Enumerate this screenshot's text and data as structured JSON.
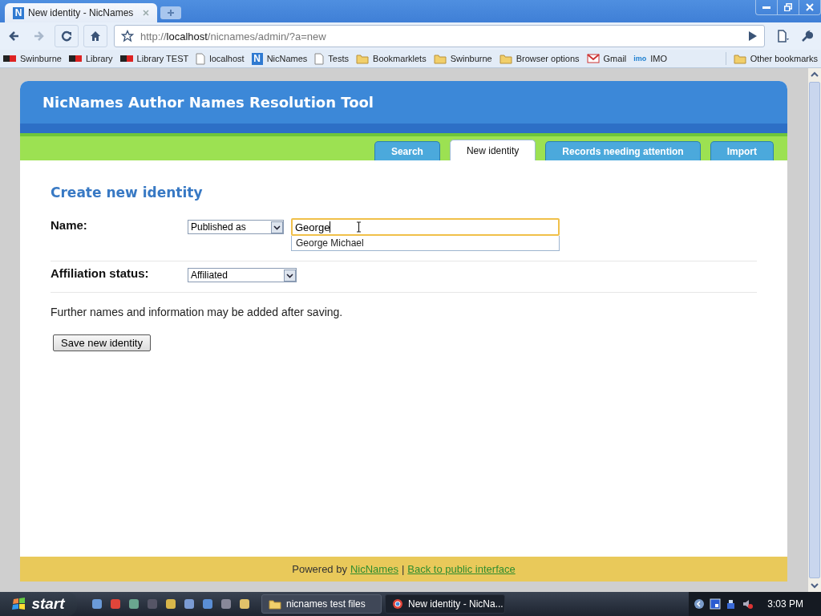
{
  "browser": {
    "tabs": [
      {
        "title": "New identity - NicNames",
        "icon_letter": "N"
      }
    ],
    "address": {
      "scheme": "http://",
      "host": "localhost",
      "path": "/nicnames/admin/?a=new"
    },
    "bookmarks": [
      {
        "kind": "site",
        "label": "Swinburne"
      },
      {
        "kind": "site",
        "label": "Library"
      },
      {
        "kind": "site",
        "label": "Library TEST"
      },
      {
        "kind": "page",
        "label": "localhost"
      },
      {
        "kind": "letter",
        "icon_letter": "N",
        "label": "NicNames"
      },
      {
        "kind": "page",
        "label": "Tests"
      },
      {
        "kind": "folder",
        "label": "Bookmarklets"
      },
      {
        "kind": "folder",
        "label": "Swinburne"
      },
      {
        "kind": "folder",
        "label": "Browser options"
      },
      {
        "kind": "mail",
        "label": "Gmail"
      },
      {
        "kind": "badge",
        "icon_letter": "imo",
        "label": "IMO"
      }
    ],
    "other_bookmarks": "Other bookmarks"
  },
  "page": {
    "title": "NicNames Author Names Resolution Tool",
    "nav": [
      {
        "label": "Search",
        "selected": false
      },
      {
        "label": "New identity",
        "selected": true
      },
      {
        "label": "Records needing attention",
        "selected": false
      },
      {
        "label": "Import",
        "selected": false
      }
    ],
    "heading": "Create new identity",
    "fields": [
      {
        "label": "Name:",
        "select": "Published as",
        "value": "George",
        "suggestions": [
          "George Michael"
        ]
      },
      {
        "label": "Affiliation status:",
        "select": "Affiliated"
      }
    ],
    "note": "Further names and information may be added after saving.",
    "save_button": "Save new identity",
    "footer": {
      "prefix": "Powered by",
      "link": "NicNames",
      "separator": "|",
      "link2": "Back to public interface"
    }
  },
  "taskbar": {
    "start": "start",
    "windows": [
      {
        "title": "nicnames test files",
        "kind": "folder",
        "selected": false
      },
      {
        "title": "New identity - NicNa...",
        "kind": "browser",
        "selected": true
      }
    ],
    "clock": "3:03 PM"
  }
}
